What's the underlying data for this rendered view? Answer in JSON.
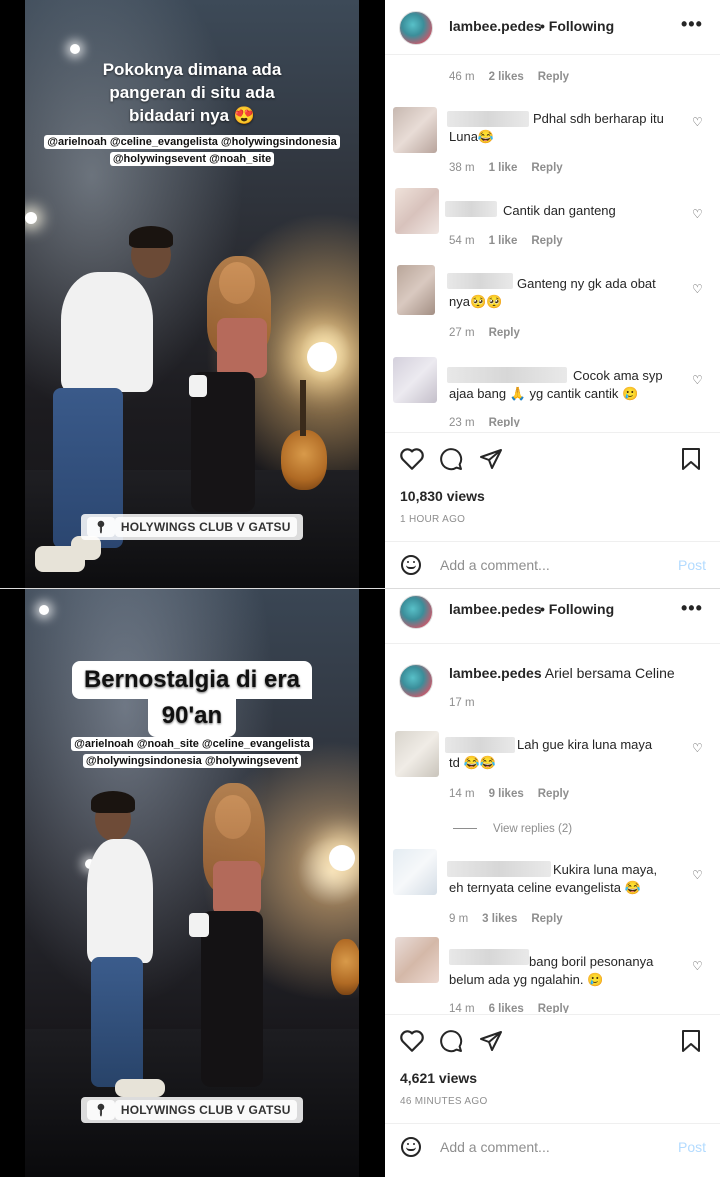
{
  "post1": {
    "story": {
      "caption_lines": [
        "Pokoknya dimana ada",
        "pangeran di situ ada",
        "bidadari nya 😍"
      ],
      "tag_lines": [
        "@arielnoah @celine_evangelista @holywingsindonesia",
        "@holywingsevent @noah_site"
      ],
      "location": "HOLYWINGS CLUB V GATSU"
    },
    "header": {
      "username": "lambee.pedes",
      "separator": "•",
      "following": "Following",
      "more": "•••"
    },
    "comments": [
      {
        "text": "",
        "meta_time": "46 m",
        "likes": "2 likes",
        "reply": "Reply"
      },
      {
        "text_lines": [
          "Pdhal sdh berharap itu",
          "Luna😂"
        ],
        "meta_time": "38 m",
        "likes": "1 like",
        "reply": "Reply"
      },
      {
        "text_lines": [
          "Cantik dan ganteng"
        ],
        "meta_time": "54 m",
        "likes": "1 like",
        "reply": "Reply"
      },
      {
        "text_lines": [
          "Ganteng ny gk ada obat",
          "nya🥺🥺"
        ],
        "meta_time": "27 m",
        "likes": "",
        "reply": "Reply"
      },
      {
        "text_lines": [
          "Cocok ama syp",
          "ajaa bang 🙏 yg cantik cantik 🥲"
        ],
        "meta_time": "23 m",
        "likes": "",
        "reply": "Reply"
      }
    ],
    "views": "10,830 views",
    "posted": "1 HOUR AGO",
    "add_comment": "Add a comment...",
    "post_label": "Post"
  },
  "post2": {
    "story": {
      "caption_lines": [
        "Bernostalgia di era",
        "90'an"
      ],
      "tag_lines": [
        "@arielnoah @noah_site @celine_evangelista",
        "@holywingsindonesia @holywingsevent"
      ],
      "location": "HOLYWINGS CLUB V GATSU"
    },
    "header": {
      "username": "lambee.pedes",
      "separator": "•",
      "following": "Following",
      "more": "•••"
    },
    "caption_comment": {
      "username": "lambee.pedes",
      "text": "Ariel bersama Celine",
      "time": "17 m"
    },
    "comments": [
      {
        "text_lines": [
          "Lah gue kira luna maya",
          "td 😂😂"
        ],
        "meta_time": "14 m",
        "likes": "9 likes",
        "reply": "Reply"
      },
      {
        "view_replies": "View replies (2)"
      },
      {
        "text_lines": [
          "Kukira luna maya,",
          "eh ternyata celine evangelista 😂"
        ],
        "meta_time": "9 m",
        "likes": "3 likes",
        "reply": "Reply"
      },
      {
        "text_lines": [
          "bang boril pesonanya",
          "belum ada yg ngalahin. 🥲"
        ],
        "meta_time": "14 m",
        "likes": "6 likes",
        "reply": "Reply"
      }
    ],
    "views": "4,621 views",
    "posted": "46 MINUTES AGO",
    "add_comment": "Add a comment...",
    "post_label": "Post"
  },
  "icons": [
    "heart-icon",
    "comment-icon",
    "share-icon",
    "bookmark-icon",
    "more-icon",
    "emoji-icon",
    "location-pin-icon"
  ]
}
